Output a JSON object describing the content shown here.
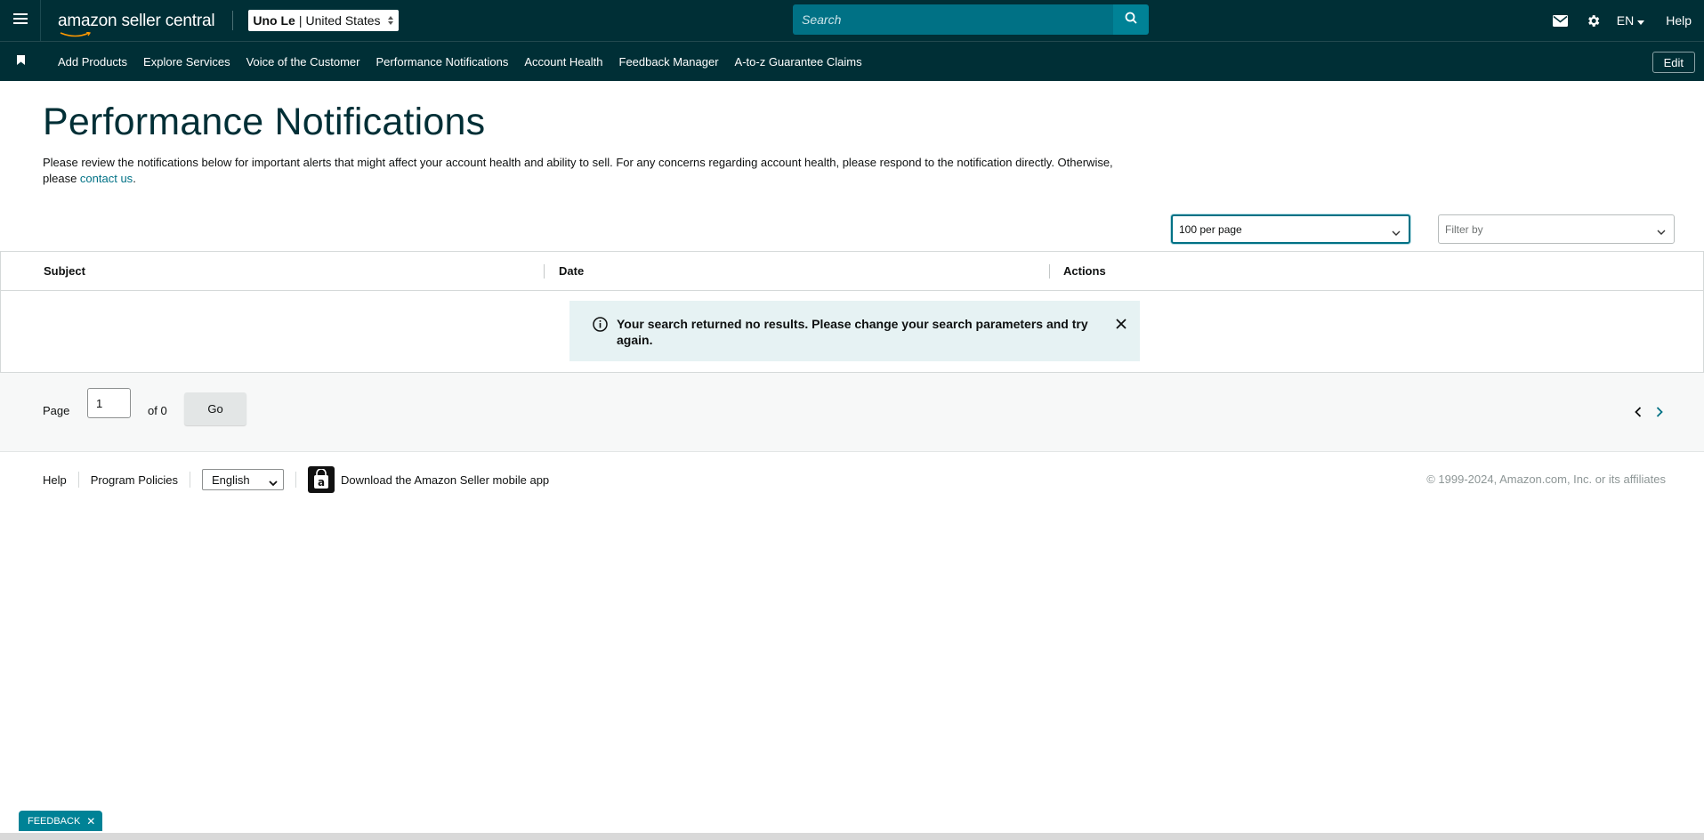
{
  "topbar": {
    "logo": "amazon seller central",
    "account_name": "Uno Le",
    "account_separator": "|",
    "account_region": "United States",
    "search_placeholder": "Search",
    "language": "EN",
    "help": "Help"
  },
  "navbar": {
    "links": [
      "Add Products",
      "Explore Services",
      "Voice of the Customer",
      "Performance Notifications",
      "Account Health",
      "Feedback Manager",
      "A-to-z Guarantee Claims"
    ],
    "edit_label": "Edit"
  },
  "page": {
    "title": "Performance Notifications",
    "description": "Please review the notifications below for important alerts that might affect your account health and ability to sell. For any concerns regarding account health, please respond to the notification directly. Otherwise, please ",
    "contact_link": "contact us",
    "description_end": "."
  },
  "controls": {
    "per_page_value": "100 per page",
    "filter_placeholder": "Filter by"
  },
  "table": {
    "columns": [
      "Subject",
      "Date",
      "Actions"
    ],
    "rows": [],
    "empty_message": "Your search returned no results. Please change your search parameters and try again."
  },
  "pager": {
    "page_label": "Page",
    "current_page": "1",
    "of_label": "of 0",
    "go_label": "Go"
  },
  "footer": {
    "help": "Help",
    "program_policies": "Program Policies",
    "language_selected": "English",
    "app_link": "Download the Amazon Seller mobile app",
    "copyright": "© 1999-2024, Amazon.com, Inc. or its affiliates"
  },
  "feedback_tab": {
    "label": "FEEDBACK",
    "close": "✕"
  },
  "colors": {
    "topbar_bg": "#002f36",
    "accent": "#007185",
    "alert_bg": "#e6f2f3"
  }
}
